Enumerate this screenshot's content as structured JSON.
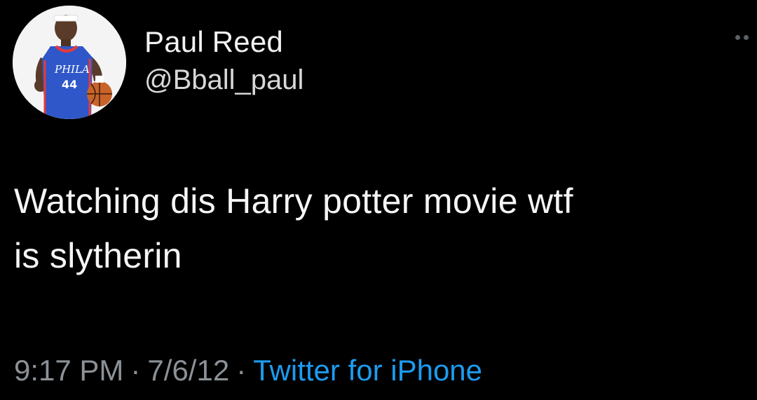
{
  "author": {
    "display_name": "Paul Reed",
    "handle": "@Bball_paul",
    "avatar_icon": "profile-photo-basketball-player",
    "jersey_text": "PHILA",
    "jersey_number": "44"
  },
  "tweet": {
    "text_line1": "Watching dis Harry potter movie wtf",
    "text_line2": "is slytherin"
  },
  "meta": {
    "time": "9:17 PM",
    "date": "7/6/12",
    "separator": "·",
    "source": "Twitter for iPhone"
  },
  "icons": {
    "more": "more-dots-icon"
  },
  "colors": {
    "background": "#000000",
    "text": "#f5f5f5",
    "secondary": "#8b9196",
    "link": "#1d9bf0"
  }
}
